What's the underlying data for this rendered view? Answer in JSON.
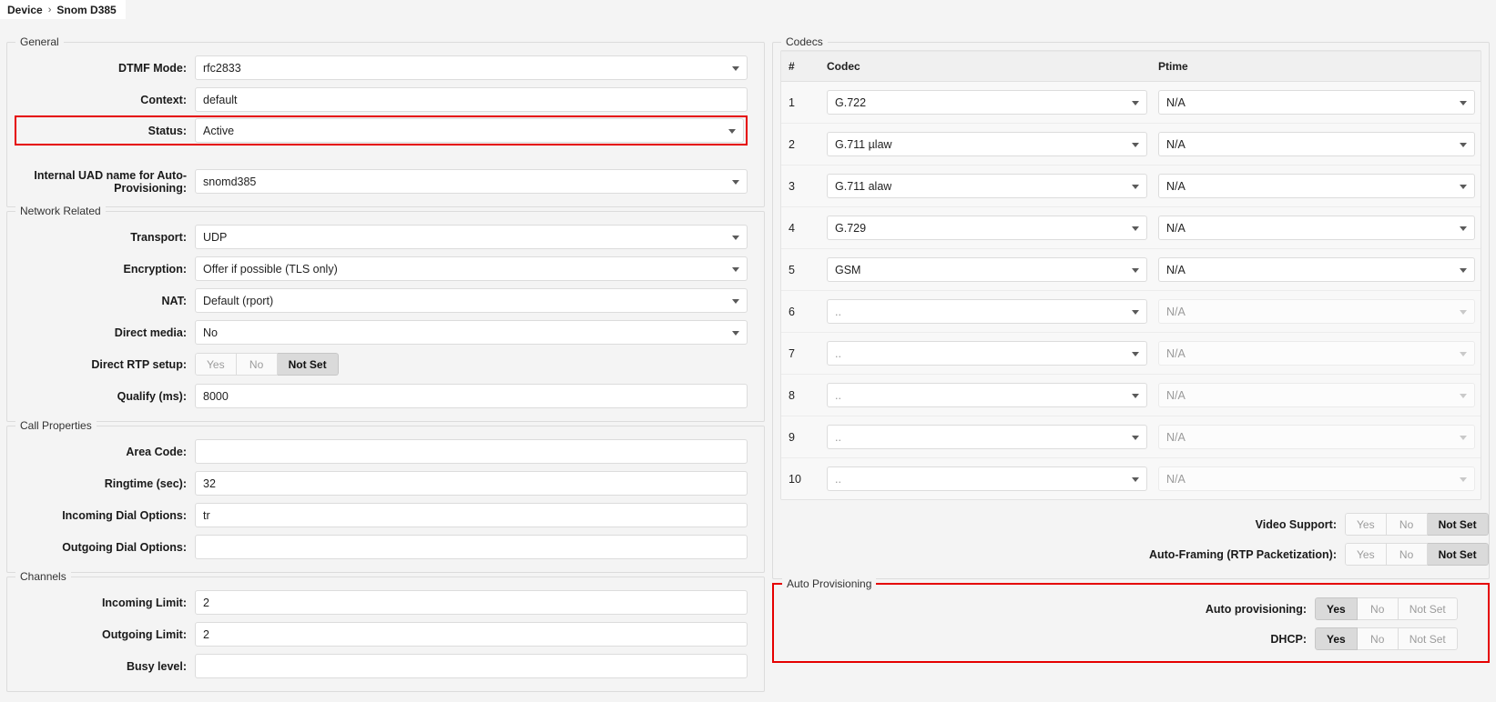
{
  "breadcrumb": {
    "root": "Device",
    "separator": "›",
    "current": "Snom D385"
  },
  "left": {
    "general": {
      "legend": "General",
      "rows": [
        {
          "label": "DTMF Mode:",
          "value": "rfc2833",
          "type": "select"
        },
        {
          "label": "Context:",
          "value": "default",
          "type": "text"
        },
        {
          "label": "Status:",
          "value": "Active",
          "type": "select",
          "highlight": true
        },
        {
          "label": "Internal UAD name for Auto-Provisioning:",
          "value": "snomd385",
          "type": "select"
        }
      ]
    },
    "network": {
      "legend": "Network Related",
      "rows": [
        {
          "label": "Transport:",
          "value": "UDP",
          "type": "select"
        },
        {
          "label": "Encryption:",
          "value": "Offer if possible (TLS only)",
          "type": "select"
        },
        {
          "label": "NAT:",
          "value": "Default (rport)",
          "type": "select"
        },
        {
          "label": "Direct media:",
          "value": "No",
          "type": "select"
        },
        {
          "label": "Direct RTP setup:",
          "type": "toggle",
          "options": [
            "Yes",
            "No",
            "Not Set"
          ],
          "selected": "Not Set"
        },
        {
          "label": "Qualify (ms):",
          "value": "8000",
          "type": "text"
        }
      ]
    },
    "call_properties": {
      "legend": "Call Properties",
      "rows": [
        {
          "label": "Area Code:",
          "value": "",
          "type": "text"
        },
        {
          "label": "Ringtime (sec):",
          "value": "32",
          "type": "text"
        },
        {
          "label": "Incoming Dial Options:",
          "value": "tr",
          "type": "text"
        },
        {
          "label": "Outgoing Dial Options:",
          "value": "",
          "type": "text"
        }
      ]
    },
    "channels": {
      "legend": "Channels",
      "rows": [
        {
          "label": "Incoming Limit:",
          "value": "2",
          "type": "text"
        },
        {
          "label": "Outgoing Limit:",
          "value": "2",
          "type": "text"
        },
        {
          "label": "Busy level:",
          "value": "",
          "type": "text"
        }
      ]
    }
  },
  "right": {
    "codecs": {
      "legend": "Codecs",
      "columns": [
        "#",
        "Codec",
        "Ptime"
      ],
      "rows": [
        {
          "index": "1",
          "codec": "G.722",
          "codec_empty": false,
          "ptime": "N/A",
          "enabled": true
        },
        {
          "index": "2",
          "codec": "G.711 µlaw",
          "codec_empty": false,
          "ptime": "N/A",
          "enabled": true
        },
        {
          "index": "3",
          "codec": "G.711 alaw",
          "codec_empty": false,
          "ptime": "N/A",
          "enabled": true
        },
        {
          "index": "4",
          "codec": "G.729",
          "codec_empty": false,
          "ptime": "N/A",
          "enabled": true
        },
        {
          "index": "5",
          "codec": "GSM",
          "codec_empty": false,
          "ptime": "N/A",
          "enabled": true
        },
        {
          "index": "6",
          "codec": "..",
          "codec_empty": true,
          "ptime": "N/A",
          "enabled": false
        },
        {
          "index": "7",
          "codec": "..",
          "codec_empty": true,
          "ptime": "N/A",
          "enabled": false
        },
        {
          "index": "8",
          "codec": "..",
          "codec_empty": true,
          "ptime": "N/A",
          "enabled": false
        },
        {
          "index": "9",
          "codec": "..",
          "codec_empty": true,
          "ptime": "N/A",
          "enabled": false
        },
        {
          "index": "10",
          "codec": "..",
          "codec_empty": true,
          "ptime": "N/A",
          "enabled": false
        }
      ],
      "toggles": [
        {
          "label": "Video Support:",
          "options": [
            "Yes",
            "No",
            "Not Set"
          ],
          "selected": "Not Set"
        },
        {
          "label": "Auto-Framing (RTP Packetization):",
          "options": [
            "Yes",
            "No",
            "Not Set"
          ],
          "selected": "Not Set"
        }
      ]
    },
    "auto_provisioning": {
      "legend": "Auto Provisioning",
      "highlight": true,
      "rows": [
        {
          "label": "Auto provisioning:",
          "options": [
            "Yes",
            "No",
            "Not Set"
          ],
          "selected": "Yes"
        },
        {
          "label": "DHCP:",
          "options": [
            "Yes",
            "No",
            "Not Set"
          ],
          "selected": "Yes"
        }
      ]
    }
  },
  "colors": {
    "highlight_border": "#e50000",
    "page_background": "#f4f4f4",
    "field_background": "#ffffff",
    "toggle_active": "#dadada"
  }
}
